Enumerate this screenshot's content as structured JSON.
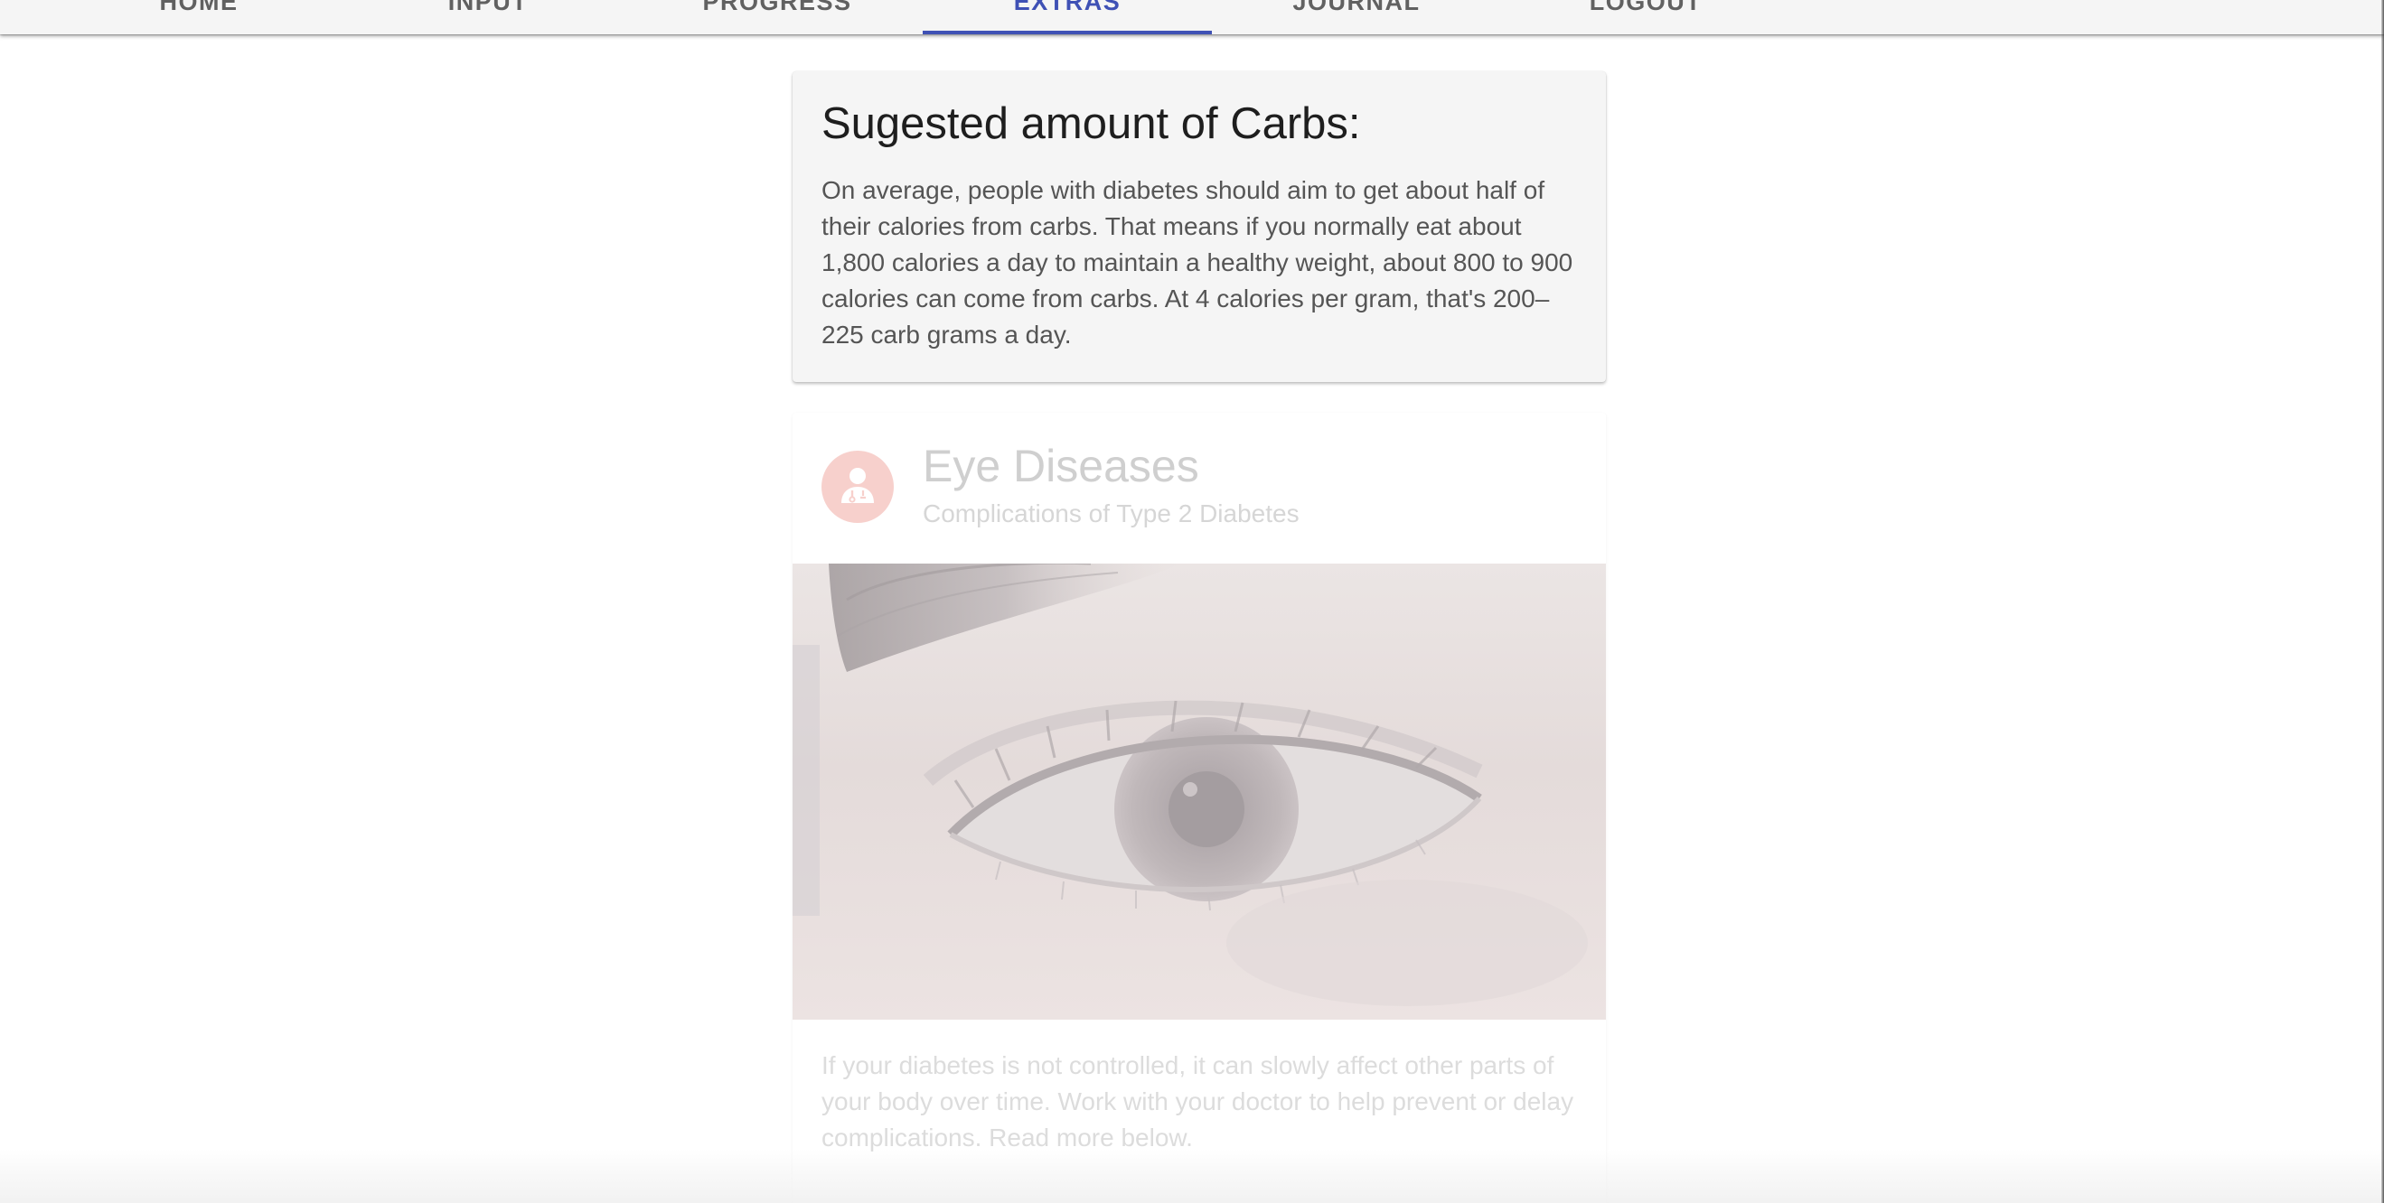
{
  "nav": {
    "tabs": [
      {
        "label": "HOME",
        "active": false
      },
      {
        "label": "INPUT",
        "active": false
      },
      {
        "label": "PROGRESS",
        "active": false
      },
      {
        "label": "EXTRAS",
        "active": true
      },
      {
        "label": "JOURNAL",
        "active": false
      },
      {
        "label": "LOGOUT",
        "active": false
      }
    ],
    "accent_color": "#3f51b5"
  },
  "carbs_card": {
    "title": "Sugested amount of Carbs:",
    "body": "On average, people with diabetes should aim to get about half of their calories from carbs. That means if you normally eat about 1,800 calories a day to maintain a healthy weight, about 800 to 900 calories can come from carbs. At 4 calories per gram, that's 200–225 carb grams a day."
  },
  "eye_card": {
    "avatar_icon": "doctor-icon",
    "avatar_color": "#f7d0cc",
    "title": "Eye Diseases",
    "subtitle": "Complications of Type 2 Diabetes",
    "image": "eye-closeup-photo",
    "text": "If your diabetes is not controlled, it can slowly affect other parts of your body over time. Work with your doctor to help prevent or delay complications. Read more below."
  }
}
